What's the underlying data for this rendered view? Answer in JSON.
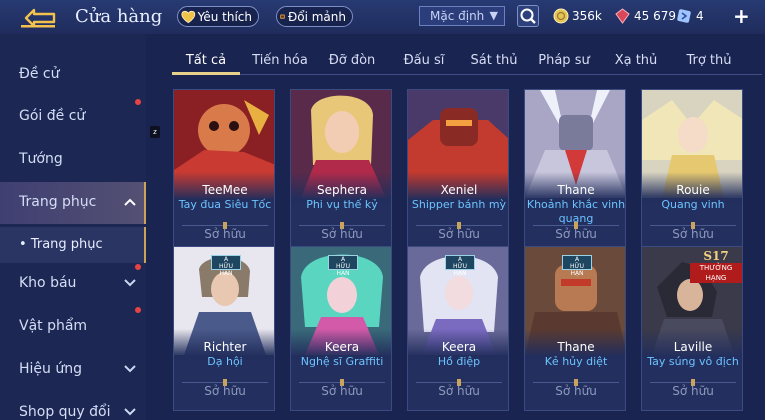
{
  "header": {
    "title": "Cửa hàng",
    "favorite_label": "Yêu thích",
    "exchange_label": "Đổi mảnh",
    "sort_value": "Mặc định",
    "gold": "356k",
    "coupons": "45 679",
    "tokens": "4"
  },
  "sidebar": {
    "items": [
      {
        "label": "Đề cử"
      },
      {
        "label": "Gói đề cử"
      },
      {
        "label": "Tướng"
      },
      {
        "label": "Trang phục"
      },
      {
        "label": "Kho báu"
      },
      {
        "label": "Vật phẩm"
      },
      {
        "label": "Hiệu ứng"
      },
      {
        "label": "Shop quy đổi"
      }
    ],
    "sub_item": "Trang phục",
    "zbadge": "z"
  },
  "tabs": [
    "Tất cả",
    "Tiến hóa",
    "Đỡ đòn",
    "Đấu sĩ",
    "Sát thủ",
    "Pháp sư",
    "Xạ thủ",
    "Trợ thủ"
  ],
  "skins": [
    {
      "hero": "TeeMee",
      "skin": "Tay đua Siêu Tốc",
      "status": "Sở hữu"
    },
    {
      "hero": "Sephera",
      "skin": "Phi vụ thế kỷ",
      "status": "Sở hữu"
    },
    {
      "hero": "Xeniel",
      "skin": "Shipper bánh mỳ",
      "status": "Sở hữu"
    },
    {
      "hero": "Thane",
      "skin": "Khoảnh khắc vinh quang",
      "status": "Sở hữu"
    },
    {
      "hero": "Rouie",
      "skin": "Quang vinh",
      "status": "Sở hữu"
    },
    {
      "hero": "Richter",
      "skin": "Dạ hội",
      "status": "Sở hữu"
    },
    {
      "hero": "Keera",
      "skin": "Nghệ sĩ Graffiti",
      "status": "Sở hữu"
    },
    {
      "hero": "Keera",
      "skin": "Hồ điệp",
      "status": "Sở hữu"
    },
    {
      "hero": "Thane",
      "skin": "Kẻ hủy diệt",
      "status": "Sở hữu"
    },
    {
      "hero": "Laville",
      "skin": "Tay súng vô địch",
      "status": "Sở hữu"
    }
  ],
  "badges": {
    "tier_a_top": "A",
    "tier_a_bottom": "HỮU HẠN",
    "season_top": "S17",
    "season_bottom": "THƯỞNG HẠNG"
  },
  "colors": {
    "accent": "#e6d28c",
    "skin_name": "#6cc3ff",
    "background": "#1a2450"
  },
  "icons": {
    "back": "back-arrow-icon",
    "favorite": "heart-icon",
    "exchange": "chest-icon",
    "search": "magnifier-icon",
    "gold": "gold-coin-icon",
    "coupon": "red-gem-icon",
    "token": "blue-ticket-icon",
    "add": "plus-icon"
  }
}
